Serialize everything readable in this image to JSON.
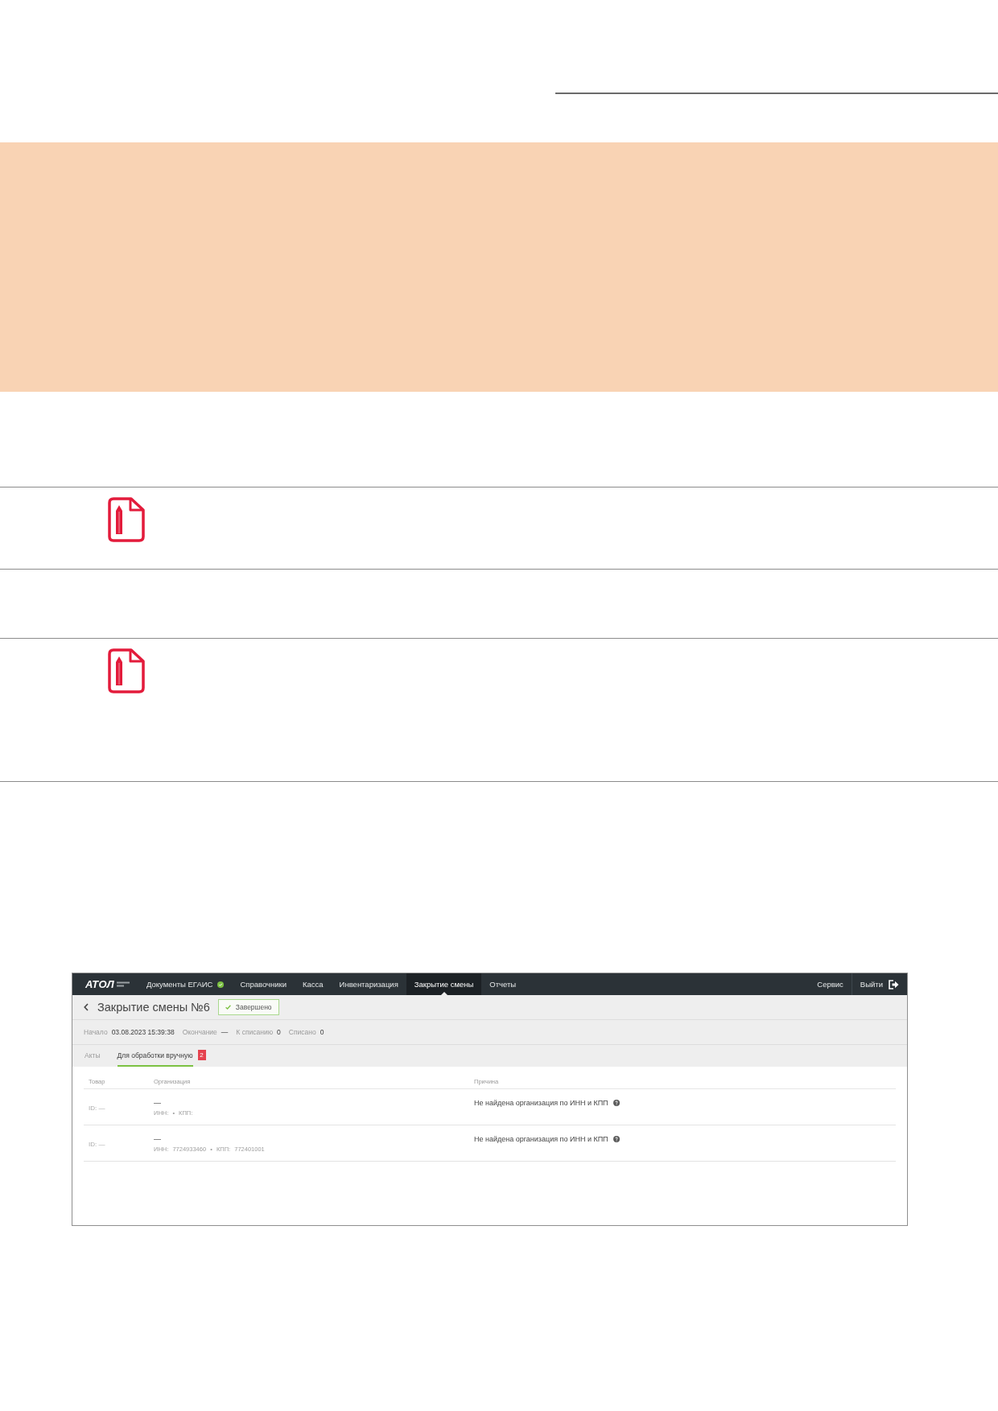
{
  "screenshot": {
    "nav": {
      "logo": "АТОЛ",
      "items": [
        {
          "label": "Документы ЕГАИС",
          "selected": false,
          "status_dot": true
        },
        {
          "label": "Справочники",
          "selected": false,
          "status_dot": false
        },
        {
          "label": "Касса",
          "selected": false,
          "status_dot": false
        },
        {
          "label": "Инвентаризация",
          "selected": false,
          "status_dot": false
        },
        {
          "label": "Закрытие смены",
          "selected": true,
          "status_dot": false
        },
        {
          "label": "Отчеты",
          "selected": false,
          "status_dot": false
        }
      ],
      "right_items": [
        {
          "label": "Сервис",
          "kind": "link"
        },
        {
          "label": "Выйти",
          "kind": "logout"
        }
      ]
    },
    "header": {
      "title": "Закрытие смены №6",
      "status": "Завершено"
    },
    "summary": [
      {
        "label": "Начало",
        "value": "03.08.2023 15:39:38"
      },
      {
        "label": "Окончание",
        "value": "—"
      },
      {
        "label": "К списанию",
        "value": "0"
      },
      {
        "label": "Списано",
        "value": "0"
      }
    ],
    "tabs": [
      {
        "label": "Акты",
        "selected": false
      },
      {
        "label": "Для обработки вручную",
        "selected": true,
        "count": "2"
      }
    ],
    "table": {
      "columns": [
        "Товар",
        "Организация",
        "Причина"
      ],
      "rows": [
        {
          "product": "ID: —",
          "organization": "—",
          "details": "ИНН: • КПП:",
          "reason": "Не найдена организация по ИНН и КПП"
        },
        {
          "product": "ID: —",
          "organization": "—",
          "details": "ИНН: 7724933460 • КПП: 772401001",
          "reason": "Не найдена организация по ИНН и КПП"
        }
      ]
    }
  }
}
